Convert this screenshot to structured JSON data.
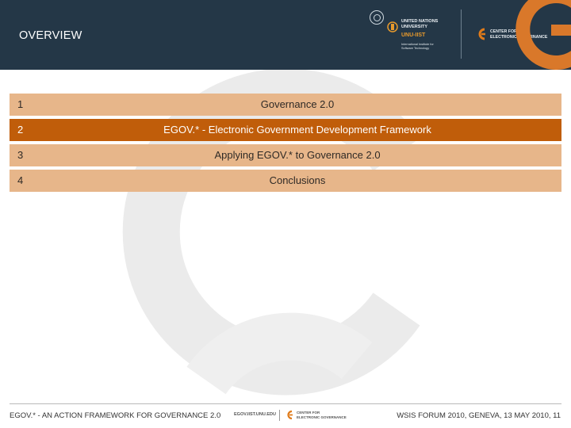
{
  "colors": {
    "header_bg": "#243747",
    "row_light": "#e7b68a",
    "row_dark": "#c05d0a",
    "accent": "#e07b1a"
  },
  "header": {
    "title": "OVERVIEW",
    "unu": {
      "name_line1": "UNITED NATIONS",
      "name_line2": "UNIVERSITY",
      "iist": "UNU-IIST",
      "sub_line1": "International Institute for",
      "sub_line2": "Software Technology"
    },
    "center": {
      "line1": "CENTER FOR",
      "line2": "ELECTRONIC GOVERNANCE"
    }
  },
  "agenda": [
    {
      "num": "1",
      "text": "Governance 2.0",
      "highlighted": false
    },
    {
      "num": "2",
      "text": "EGOV.* - Electronic Government Development Framework",
      "highlighted": true
    },
    {
      "num": "3",
      "text": "Applying EGOV.* to Governance 2.0",
      "highlighted": false
    },
    {
      "num": "4",
      "text": "Conclusions",
      "highlighted": false
    }
  ],
  "footer": {
    "left": "EGOV.* - AN ACTION FRAMEWORK FOR GOVERNANCE 2.0",
    "url": "EGOV.IIST.UNU.EDU",
    "center_line1": "CENTER FOR",
    "center_line2": "ELECTRONIC GOVERNANCE",
    "right": "WSIS FORUM 2010, GENEVA, 13 MAY 2010, 11"
  }
}
